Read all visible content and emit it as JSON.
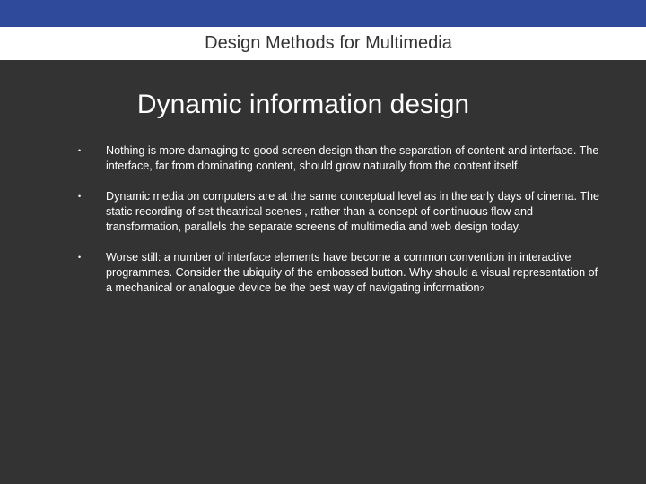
{
  "header": {
    "title": "Design Methods for Multimedia"
  },
  "slide": {
    "title": "Dynamic information design",
    "bullet_marker": "•",
    "bullets": [
      {
        "text": "Nothing is more damaging to good screen design than the separation of content and interface. The interface, far from dominating content, should grow naturally from the content itself."
      },
      {
        "text": "Dynamic media on computers are at the same conceptual level as in the early days of cinema. The static recording of set theatrical scenes , rather than a concept of continuous flow and transformation, parallels the separate screens of multimedia and web design today."
      },
      {
        "text": "Worse still: a number of interface elements have become a common convention in interactive programmes. Consider the ubiquity of the embossed button. Why should a visual representation of a mechanical or analogue device be the best way of navigating information",
        "trailing": "?"
      }
    ]
  },
  "colors": {
    "top_band": "#2f4a9a",
    "header_bar": "#ffffff",
    "background": "#333333",
    "text": "#ffffff"
  }
}
